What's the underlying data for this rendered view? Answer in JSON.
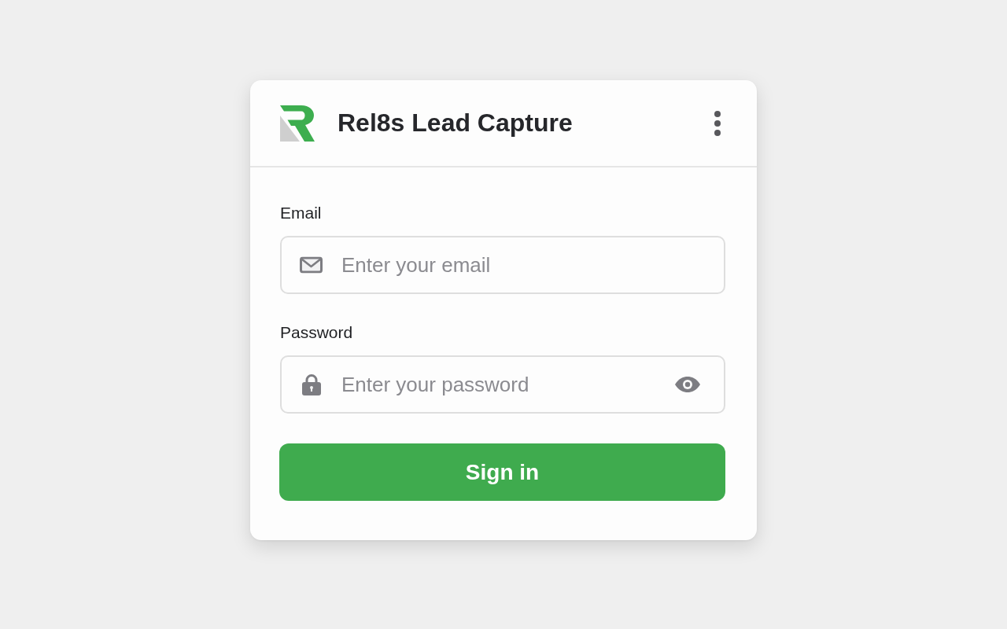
{
  "app": {
    "title": "Rel8s Lead Capture"
  },
  "fields": [
    {
      "kind": "email",
      "label": "Email",
      "placeholder": "Enter your email"
    },
    {
      "kind": "password",
      "label": "Password",
      "placeholder": "Enter your password"
    }
  ],
  "submit": {
    "label": "Sign in"
  }
}
